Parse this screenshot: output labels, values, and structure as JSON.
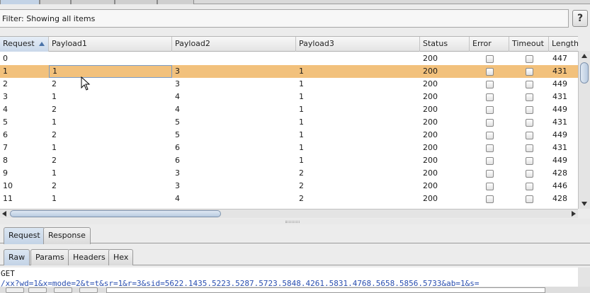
{
  "filter": {
    "label": "Filter: Showing all items",
    "help": "?"
  },
  "columns": [
    "Request",
    "Payload1",
    "Payload2",
    "Payload3",
    "Status",
    "Error",
    "Timeout",
    "Length"
  ],
  "sorted_column": "Request",
  "selected_row_index": 1,
  "rows": [
    {
      "request": "0",
      "p1": "",
      "p2": "",
      "p3": "",
      "status": "200",
      "length": "447"
    },
    {
      "request": "1",
      "p1": "1",
      "p2": "3",
      "p3": "1",
      "status": "200",
      "length": "431"
    },
    {
      "request": "2",
      "p1": "2",
      "p2": "3",
      "p3": "1",
      "status": "200",
      "length": "449"
    },
    {
      "request": "3",
      "p1": "1",
      "p2": "4",
      "p3": "1",
      "status": "200",
      "length": "431"
    },
    {
      "request": "4",
      "p1": "2",
      "p2": "4",
      "p3": "1",
      "status": "200",
      "length": "449"
    },
    {
      "request": "5",
      "p1": "1",
      "p2": "5",
      "p3": "1",
      "status": "200",
      "length": "431"
    },
    {
      "request": "6",
      "p1": "2",
      "p2": "5",
      "p3": "1",
      "status": "200",
      "length": "449"
    },
    {
      "request": "7",
      "p1": "1",
      "p2": "6",
      "p3": "1",
      "status": "200",
      "length": "431"
    },
    {
      "request": "8",
      "p1": "2",
      "p2": "6",
      "p3": "1",
      "status": "200",
      "length": "449"
    },
    {
      "request": "9",
      "p1": "1",
      "p2": "3",
      "p3": "2",
      "status": "200",
      "length": "428"
    },
    {
      "request": "10",
      "p1": "2",
      "p2": "3",
      "p3": "2",
      "status": "200",
      "length": "446"
    },
    {
      "request": "11",
      "p1": "1",
      "p2": "4",
      "p3": "2",
      "status": "200",
      "length": "428"
    }
  ],
  "request_tabs": [
    "Request",
    "Response"
  ],
  "request_tab_active": "Request",
  "view_tabs": [
    "Raw",
    "Params",
    "Headers",
    "Hex"
  ],
  "view_tab_active": "Raw",
  "raw_text": [
    "GET",
    "/xx?wd=1&x=mode=2&t=t&sr=1&r=3&sid=5622.1435.5223.5287.5723.5848.4261.5831.4768.5658.5856.5733&ab=1&s="
  ],
  "colors": {
    "selected_row": "#f2c17c",
    "accent": "#4a73a8"
  }
}
